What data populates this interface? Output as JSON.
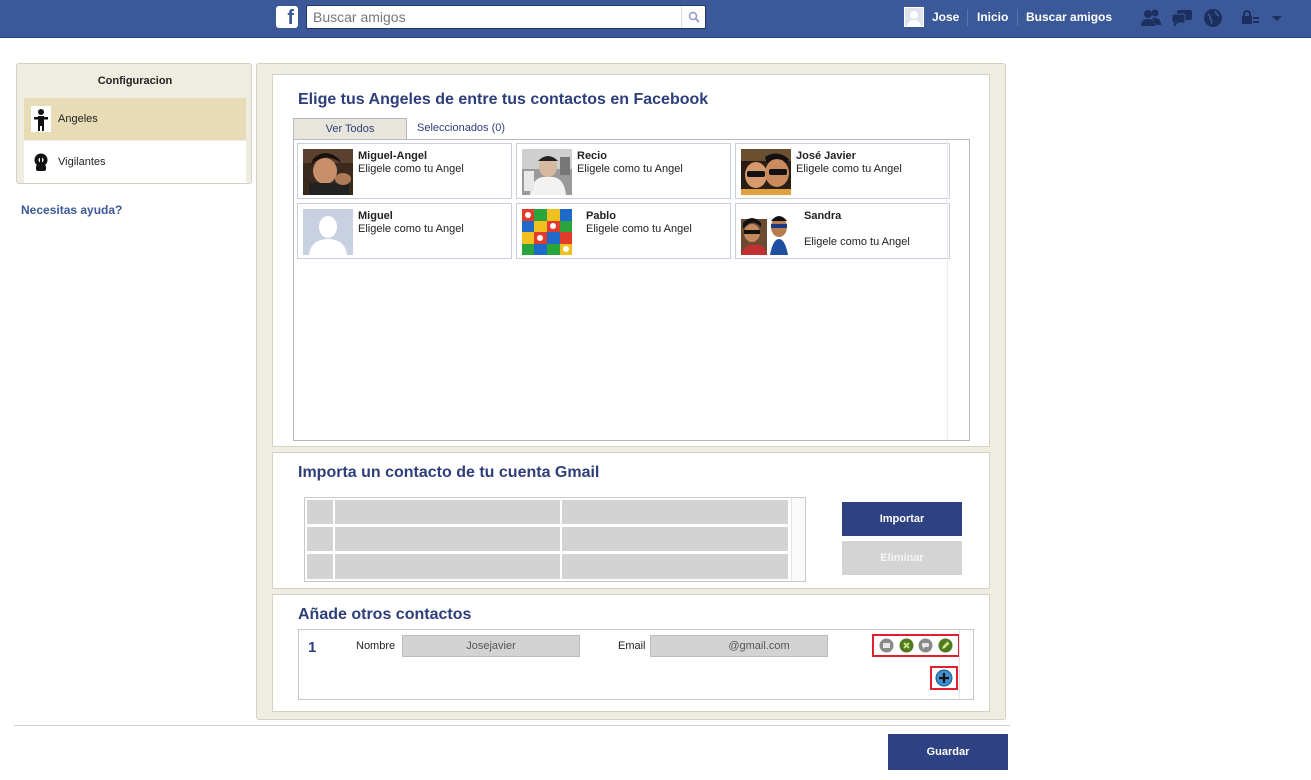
{
  "topbar": {
    "search_placeholder": "Buscar amigos",
    "user_name": "Jose",
    "nav_home": "Inicio",
    "nav_find": "Buscar amigos"
  },
  "sidebar": {
    "title": "Configuracion",
    "items": [
      {
        "label": "Angeles",
        "icon": "angel-icon",
        "active": true
      },
      {
        "label": "Vigilantes",
        "icon": "guardian-icon",
        "active": false
      }
    ],
    "help": "Necesitas ayuda?"
  },
  "facebook_section": {
    "title": "Elige tus Angeles de entre tus contactos en Facebook",
    "tab_all": "Ver Todos",
    "tab_selected": "Seleccionados (0)",
    "friends": [
      {
        "name": "Miguel-Angel",
        "action": "Eligele como tu Angel"
      },
      {
        "name": "Recio",
        "action": "Eligele como tu Angel"
      },
      {
        "name": "José Javier",
        "action": "Eligele como tu Angel"
      },
      {
        "name": "Miguel",
        "action": "Eligele como tu Angel"
      },
      {
        "name": "Pablo",
        "action": "Eligele como tu Angel"
      },
      {
        "name": "Sandra",
        "action": "Eligele como tu Angel"
      }
    ]
  },
  "gmail_section": {
    "title": "Importa un contacto de tu cuenta Gmail",
    "import_label": "Importar",
    "delete_label": "Eliminar"
  },
  "contacts_section": {
    "title": "Añade otros contactos",
    "rows": [
      {
        "number": "1",
        "name_label": "Nombre",
        "name_value": "Josejavier",
        "email_label": "Email",
        "email_value": "@gmail.com"
      }
    ]
  },
  "footer": {
    "save_label": "Guardar"
  },
  "colors": {
    "brand": "#3b5998",
    "title_blue": "#2e3e7a",
    "panel_bg": "#efece2",
    "highlight_red": "#e0202e"
  }
}
